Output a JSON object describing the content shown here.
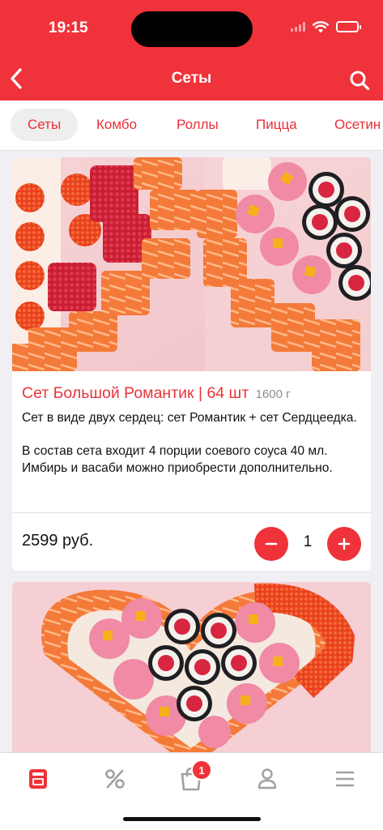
{
  "status_bar": {
    "time": "19:15"
  },
  "header": {
    "title": "Сеты"
  },
  "tabs": [
    {
      "label": "Сеты",
      "active": true
    },
    {
      "label": "Комбо",
      "active": false
    },
    {
      "label": "Роллы",
      "active": false
    },
    {
      "label": "Пицца",
      "active": false
    },
    {
      "label": "Осетин",
      "active": false
    }
  ],
  "products": [
    {
      "name": "Сет Большой Романтик | 64 шт",
      "weight": "1600 г",
      "description": [
        "Сет в виде двух сердец: сет Романтик + сет Сердцеедка.",
        "В состав сета входит 4 порции соевого соуса 40 мл. Имбирь и васаби можно приобрести дополнительно."
      ],
      "price": "2599 руб.",
      "quantity": "1"
    },
    {
      "name": "",
      "weight": "",
      "description": [],
      "price": "",
      "quantity": ""
    }
  ],
  "bottom_nav": {
    "items": [
      {
        "icon": "menu-card-icon",
        "active": true
      },
      {
        "icon": "percent-icon",
        "active": false
      },
      {
        "icon": "cart-bag-icon",
        "active": false
      },
      {
        "icon": "profile-icon",
        "active": false
      },
      {
        "icon": "hamburger-icon",
        "active": false
      }
    ],
    "cart_badge": "1"
  },
  "colors": {
    "accent": "#f0323a",
    "background": "#efeff4",
    "text": "#111111",
    "muted": "#8e8e93",
    "inactive_icon": "#a0a0a6"
  }
}
